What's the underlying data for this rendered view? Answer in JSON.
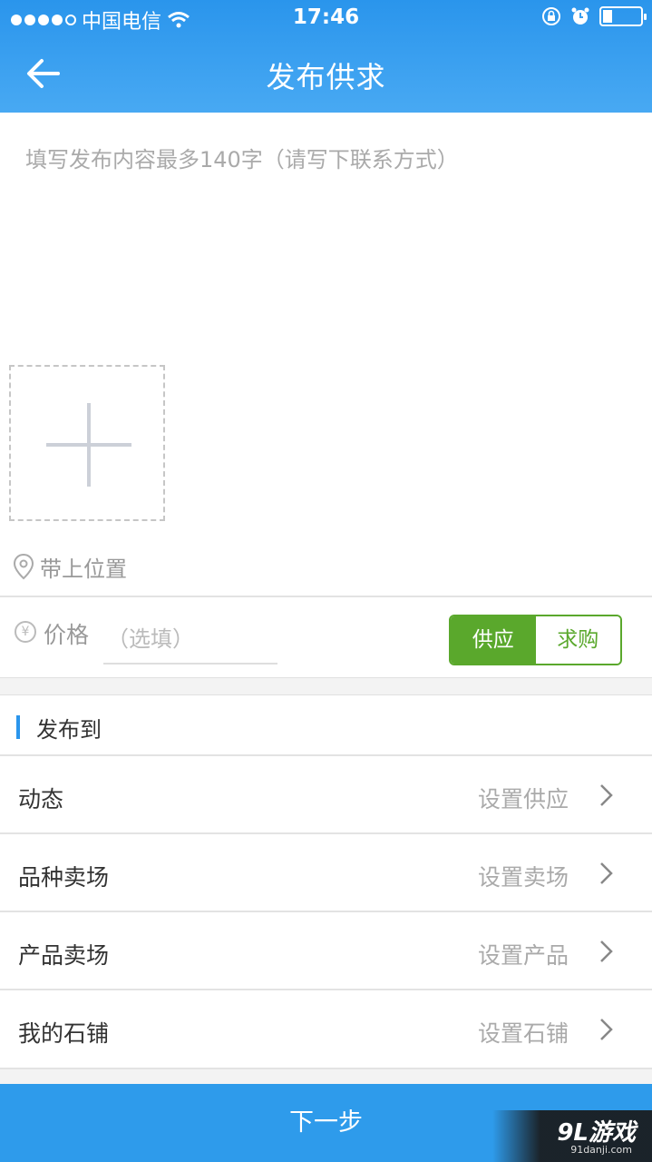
{
  "status_bar": {
    "carrier": "中国电信",
    "time": "17:46"
  },
  "nav": {
    "title": "发布供求"
  },
  "compose": {
    "placeholder": "填写发布内容最多140字（请写下联系方式）",
    "location_label": "带上位置"
  },
  "price": {
    "label": "价格",
    "placeholder": "（选填）",
    "yen_symbol": "¥"
  },
  "type_toggle": {
    "options": [
      "供应",
      "求购"
    ],
    "selected": "供应"
  },
  "publish_to": {
    "header": "发布到",
    "rows": [
      {
        "label": "动态",
        "action": "设置供应"
      },
      {
        "label": "品种卖场",
        "action": "设置卖场"
      },
      {
        "label": "产品卖场",
        "action": "设置产品"
      },
      {
        "label": "我的石铺",
        "action": "设置石铺"
      }
    ]
  },
  "footer": {
    "next_label": "下一步"
  },
  "watermark": {
    "brand": "9L游戏",
    "url": "91danji.com"
  },
  "colors": {
    "header_blue": "#2a95ec",
    "toggle_green": "#5aa82c",
    "button_blue": "#2e9beb"
  }
}
